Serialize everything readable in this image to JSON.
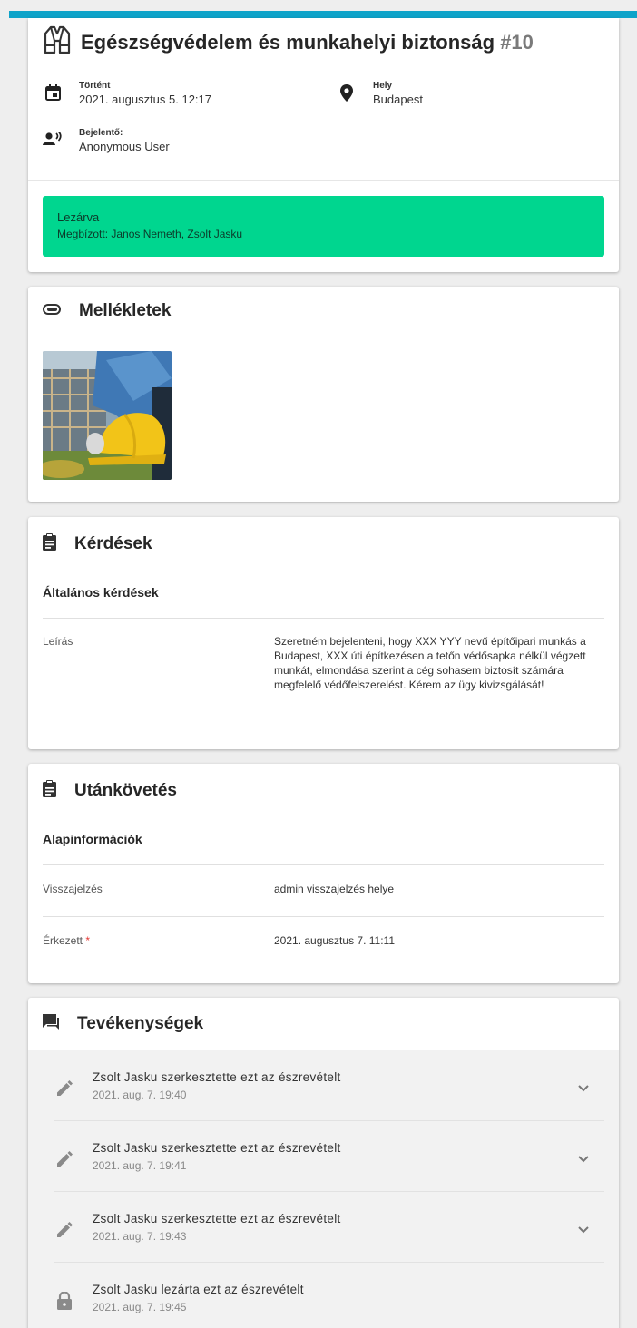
{
  "header": {
    "title": "Egészségvédelem és munkahelyi biztonság",
    "number": "#10",
    "icon": "safety-vest-icon",
    "occurred_label": "Történt",
    "occurred_value": "2021. augusztus 5. 12:17",
    "location_label": "Hely",
    "location_value": "Budapest",
    "reporter_label": "Bejelentő:",
    "reporter_value": "Anonymous User",
    "status": "Lezárva",
    "assignees": "Megbízott: Janos Nemeth, Zsolt Jasku",
    "status_color": "#00d68f",
    "accent_color": "#0ea3c9"
  },
  "attachments": {
    "title": "Mellékletek",
    "icon": "attachment-icon",
    "items": [
      {
        "type": "image",
        "icon": "hard-hat-photo"
      }
    ]
  },
  "questions": {
    "title": "Kérdések",
    "icon": "clipboard-icon",
    "section": "Általános kérdések",
    "fields": [
      {
        "label": "Leírás",
        "value": "Szeretném bejelenteni, hogy XXX YYY nevű építőipari munkás a Budapest, XXX úti építkezésen a tetőn védősapka nélkül végzett munkát, elmondása szerint a cég sohasem biztosít számára megfelelő védőfelszerelést. Kérem az ügy kivizsgálását!"
      }
    ]
  },
  "followup": {
    "title": "Utánkövetés",
    "icon": "clipboard-icon",
    "section": "Alapinformációk",
    "fields": [
      {
        "label": "Visszajelzés",
        "value": "admin visszajelzés helye",
        "required": false
      },
      {
        "label": "Érkezett",
        "value": "2021. augusztus 7. 11:11",
        "required": true,
        "required_mark": "*"
      }
    ]
  },
  "activities": {
    "title": "Tevékenységek",
    "icon": "comments-icon",
    "items": [
      {
        "icon": "pencil-icon",
        "text": "Zsolt Jasku szerkesztette ezt az észrevételt",
        "time": "2021. aug. 7. 19:40",
        "expandable": true
      },
      {
        "icon": "pencil-icon",
        "text": "Zsolt Jasku szerkesztette ezt az észrevételt",
        "time": "2021. aug. 7. 19:41",
        "expandable": true
      },
      {
        "icon": "pencil-icon",
        "text": "Zsolt Jasku szerkesztette ezt az észrevételt",
        "time": "2021. aug. 7. 19:43",
        "expandable": true
      },
      {
        "icon": "lock-icon",
        "text": "Zsolt Jasku lezárta ezt az észrevételt",
        "time": "2021. aug. 7. 19:45",
        "expandable": false
      }
    ]
  }
}
